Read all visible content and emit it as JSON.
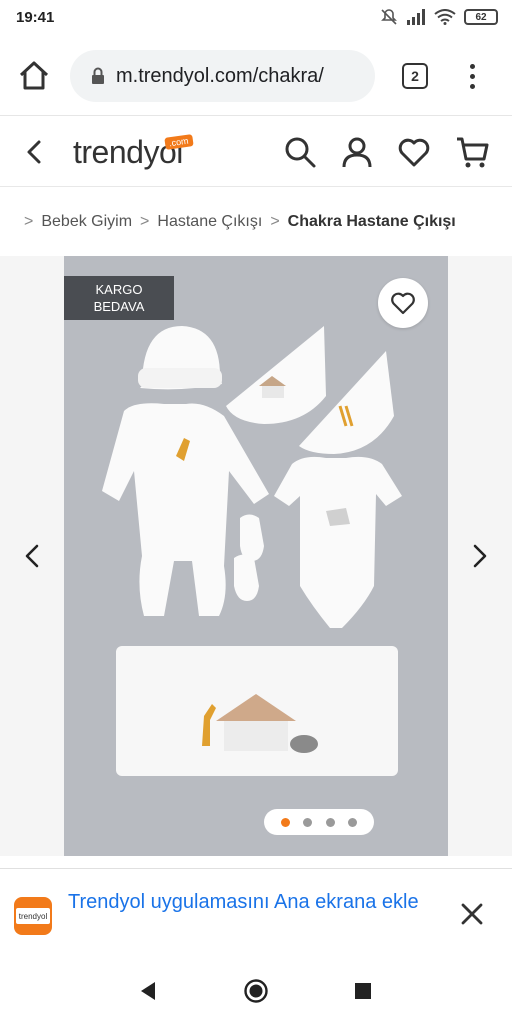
{
  "status_bar": {
    "time": "19:41",
    "battery": "62"
  },
  "browser": {
    "url": "m.trendyol.com/chakra/",
    "tab_count": "2"
  },
  "site": {
    "logo_text": "trendyol",
    "logo_suffix": ".com",
    "brand_color": "#f27a1a"
  },
  "breadcrumb": {
    "items": [
      "Bebek Giyim",
      "Hastane Çıkışı"
    ],
    "current": "Chakra Hastane Çıkışı"
  },
  "product": {
    "badge_line1": "KARGO",
    "badge_line2": "BEDAVA",
    "gallery_index": 1,
    "gallery_total": 4
  },
  "app_banner": {
    "icon_label": "trendyol",
    "text": "Trendyol uygulamasını Ana ekrana ekle"
  }
}
